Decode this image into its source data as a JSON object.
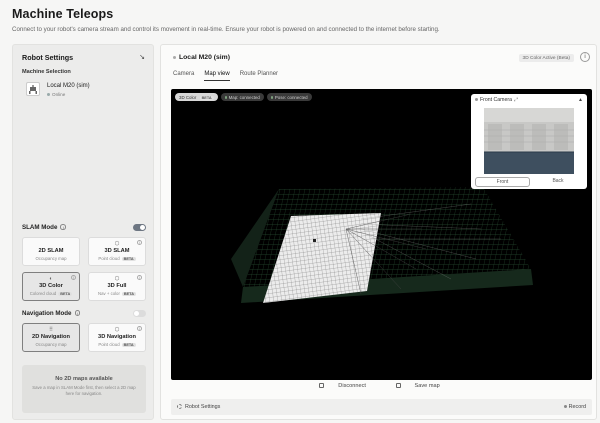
{
  "header": {
    "title": "Machine Teleops",
    "subtitle": "Connect to your robot's camera stream and control its movement in real-time. Ensure your robot is powered on and connected to the internet before starting."
  },
  "left_panel": {
    "title": "Robot Settings",
    "collapse_icon": "↘",
    "machine_selection_label": "Machine Selection",
    "machine": {
      "name": "Local M20 (sim)",
      "status": "Online"
    },
    "slam": {
      "label": "SLAM Mode",
      "enabled": true,
      "options": [
        {
          "title": "2D SLAM",
          "subtitle": "Occupancy map",
          "badge": ""
        },
        {
          "title": "3D SLAM",
          "subtitle": "Point cloud",
          "badge": "BETA"
        },
        {
          "title": "3D Color",
          "subtitle": "Colored cloud",
          "badge": "BETA"
        },
        {
          "title": "3D Full",
          "subtitle": "Nav + color",
          "badge": "BETA"
        }
      ]
    },
    "navigation": {
      "label": "Navigation Mode",
      "enabled": false,
      "options": [
        {
          "title": "2D Navigation",
          "subtitle": "Occupancy map"
        },
        {
          "title": "3D Navigation",
          "subtitle": "Point cloud",
          "badge": "BETA"
        }
      ]
    },
    "no_maps": {
      "title": "No 2D maps available",
      "message": "Save a map in SLAM Mode first, then select a 2D map here for navigation."
    }
  },
  "right_panel": {
    "title": "Local M20 (sim)",
    "active_badge": "3D Color Active (Beta)",
    "tabs": [
      "Camera",
      "Map view",
      "Route Planner"
    ],
    "active_tab": "Map view",
    "chips": [
      {
        "label": "3D Color",
        "badge": "BETA"
      },
      {
        "label": "Map: connected"
      },
      {
        "label": "Pose: connected"
      }
    ],
    "camera": {
      "title": "Front Camera",
      "buttons": [
        "Front",
        "Back"
      ]
    },
    "actions": [
      "Disconnect",
      "Save map"
    ],
    "bottom": {
      "settings": "Robot Settings",
      "record": "Record"
    }
  },
  "colors": {
    "accent": "#6d7682",
    "viewport_bg": "#000000",
    "panel_bg": "#ececeb"
  }
}
